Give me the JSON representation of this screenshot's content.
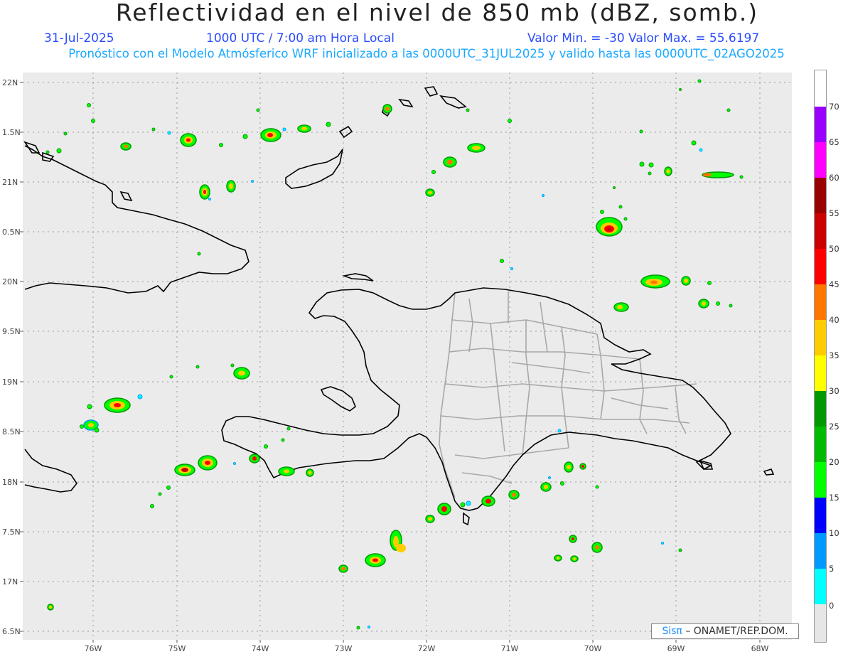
{
  "header": {
    "title": "Reflectividad en el nivel de 850 mb (dBZ, somb.)",
    "date": "31-Jul-2025",
    "time": "1000 UTC / 7:00 am Hora Local",
    "minmax": "Valor Min. = -30  Valor Max. = 55.6197",
    "model_info": "Pronóstico con el Modelo Atmósferico WRF inicializado a las 0000UTC_31JUL2025 y valido hasta las  0000UTC_02AGO2025"
  },
  "axes": {
    "lat_labels": [
      "22N",
      "1.5N",
      "21N",
      "0.5N",
      "20N",
      "9.5N",
      "19N",
      "8.5N",
      "18N",
      "7.5N",
      "17N",
      "6.5N"
    ],
    "lon_labels": [
      "76W",
      "75W",
      "74W",
      "73W",
      "72W",
      "71W",
      "70W",
      "69W",
      "68W"
    ]
  },
  "colorbar": {
    "levels": [
      "70",
      "65",
      "60",
      "55",
      "50",
      "45",
      "40",
      "35",
      "30",
      "25",
      "20",
      "15",
      "10",
      "5",
      "0"
    ],
    "colors": [
      "#9900ff",
      "#ff00ff",
      "#990000",
      "#cc0000",
      "#ff0000",
      "#ff7700",
      "#ffcc00",
      "#ffff00",
      "#009900",
      "#00bb00",
      "#00ff00",
      "#0000ff",
      "#0099ff",
      "#00ffff",
      "#ffffff"
    ]
  },
  "credit": {
    "brand": "Sisπ",
    "org": "– ONAMET/REP.DOM."
  },
  "map": {
    "background": "#ebebeb",
    "grid_color": "#999999"
  }
}
